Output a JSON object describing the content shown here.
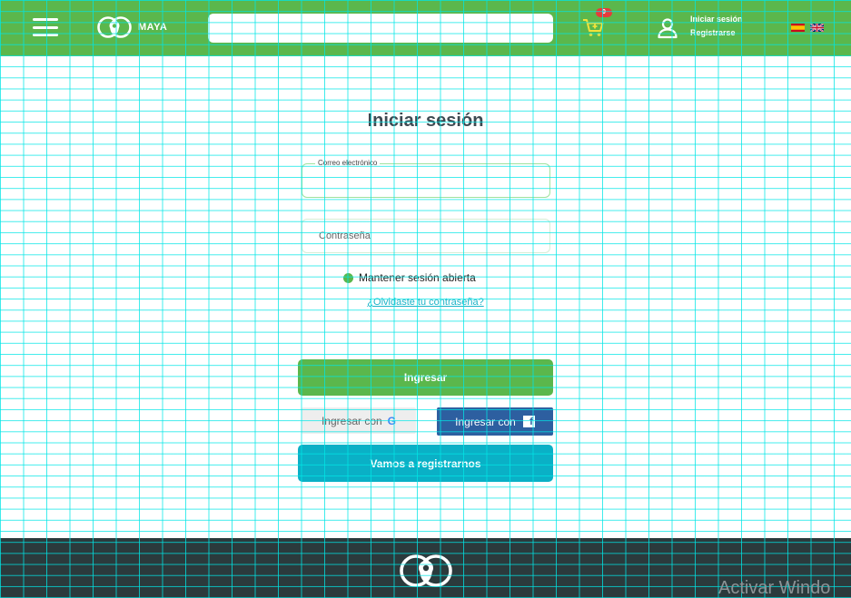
{
  "header": {
    "brand": "MAYA",
    "search_placeholder": "",
    "cart_count": "0",
    "login_link": "Iniciar sesión",
    "register_link": "Registrarse"
  },
  "main": {
    "title": "Iniciar sesión",
    "email_label": "Correo electrónico",
    "email_value": "",
    "password_placeholder": "Contraseña",
    "keep_session_label": "Mantener sesión abierta",
    "forgot_link": "¿Olvidaste tu contraseña?",
    "login_button": "Ingresar",
    "google_button": "Ingresar con",
    "facebook_button": "Ingresar con",
    "register_button": "Vamos a registrarnos"
  },
  "footer": {
    "watermark": "Activar Windo"
  },
  "colors": {
    "header_green": "#5bb74c",
    "register_cyan": "#0ab0c6",
    "facebook_blue": "#2d5fa0",
    "footer_dark": "#2b3a3c"
  },
  "icons": {
    "menu": "hamburger-icon",
    "logo": "maya-logo",
    "cart": "cart-icon",
    "user": "user-icon",
    "flag_es": "spain-flag-icon",
    "flag_en": "uk-flag-icon",
    "google": "google-icon",
    "facebook": "facebook-icon"
  }
}
